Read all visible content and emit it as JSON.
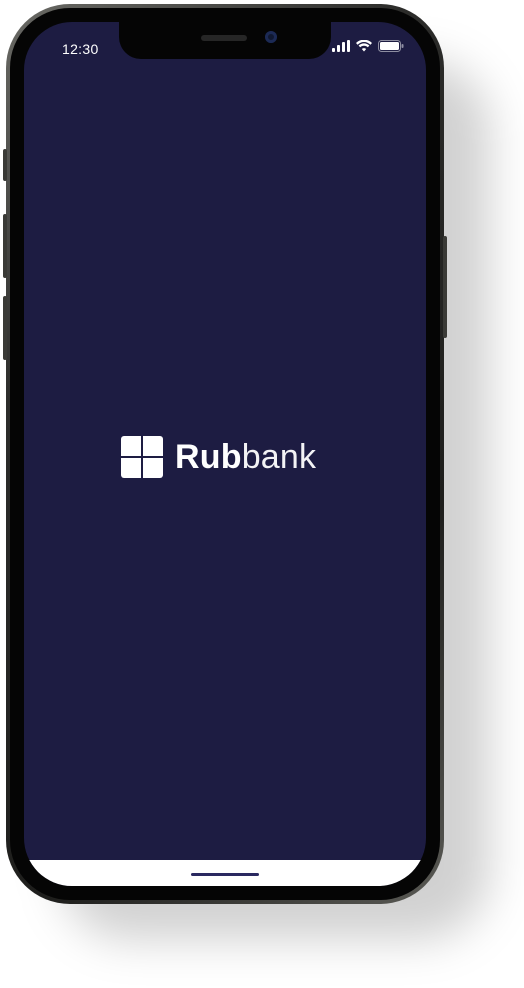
{
  "status_bar": {
    "time": "12:30",
    "icons": [
      "cellular-signal-icon",
      "wifi-icon",
      "battery-icon"
    ]
  },
  "splash": {
    "brand_bold": "Rub",
    "brand_light": "bank",
    "logo_icon": "rubbank-logo-icon"
  },
  "colors": {
    "background": "#1d1c42",
    "brand_text": "#ffffff",
    "home_area": "#ffffff",
    "home_indicator": "#2a2960"
  }
}
